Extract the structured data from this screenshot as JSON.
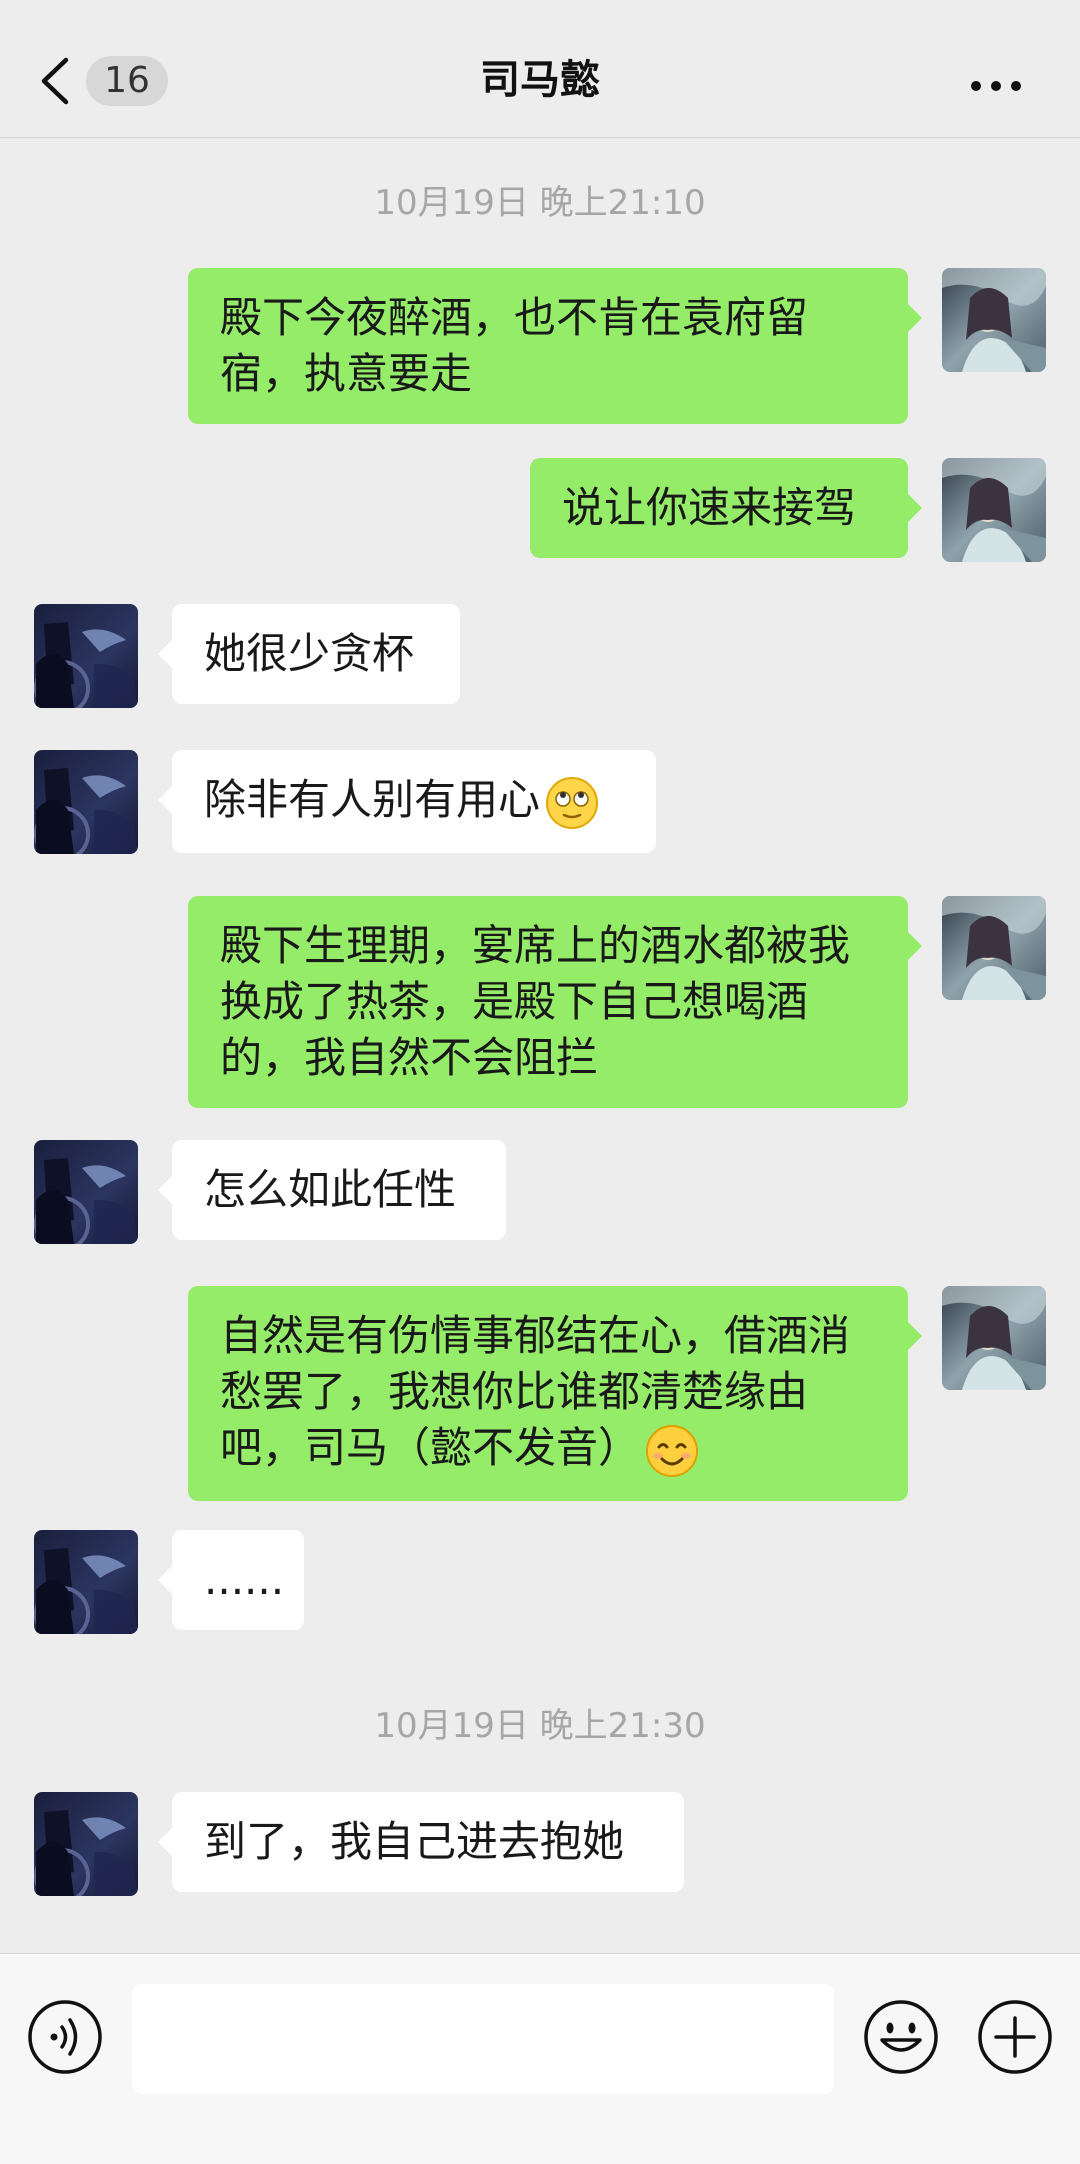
{
  "header": {
    "unread_count": "16",
    "title": "司马懿"
  },
  "timestamps": {
    "first": "10月19日 晚上21:10",
    "second": "10月19日 晚上21:30"
  },
  "messages": [
    {
      "side": "out",
      "text": "殿下今夜醉酒，也不肯在袁府留宿，执意要走"
    },
    {
      "side": "out",
      "text": "说让你速来接驾"
    },
    {
      "side": "in",
      "text": "她很少贪杯"
    },
    {
      "side": "in",
      "text": "除非有人别有用心",
      "emoji": "rolling-eyes-emoji"
    },
    {
      "side": "out",
      "text": "殿下生理期，宴席上的酒水都被我换成了热茶，是殿下自己想喝酒的，我自然不会阻拦"
    },
    {
      "side": "in",
      "text": "怎么如此任性"
    },
    {
      "side": "out",
      "text": "自然是有伤情事郁结在心，借酒消愁罢了，我想你比谁都清楚缘由吧，司马（懿不发音）",
      "emoji": "smiling-emoji"
    },
    {
      "side": "in",
      "text": "......"
    },
    {
      "side": "in",
      "text": "到了，我自己进去抱她"
    }
  ],
  "input": {
    "value": "",
    "placeholder": ""
  },
  "icons": {
    "back": "chevron-left-icon",
    "more": "ellipsis-icon",
    "voice": "voice-icon",
    "emoji": "emoji-icon",
    "plus": "plus-icon"
  },
  "colors": {
    "background": "#ededed",
    "outgoing_bubble": "#95ec69",
    "incoming_bubble": "#ffffff",
    "timestamp": "#a6a6a6"
  }
}
